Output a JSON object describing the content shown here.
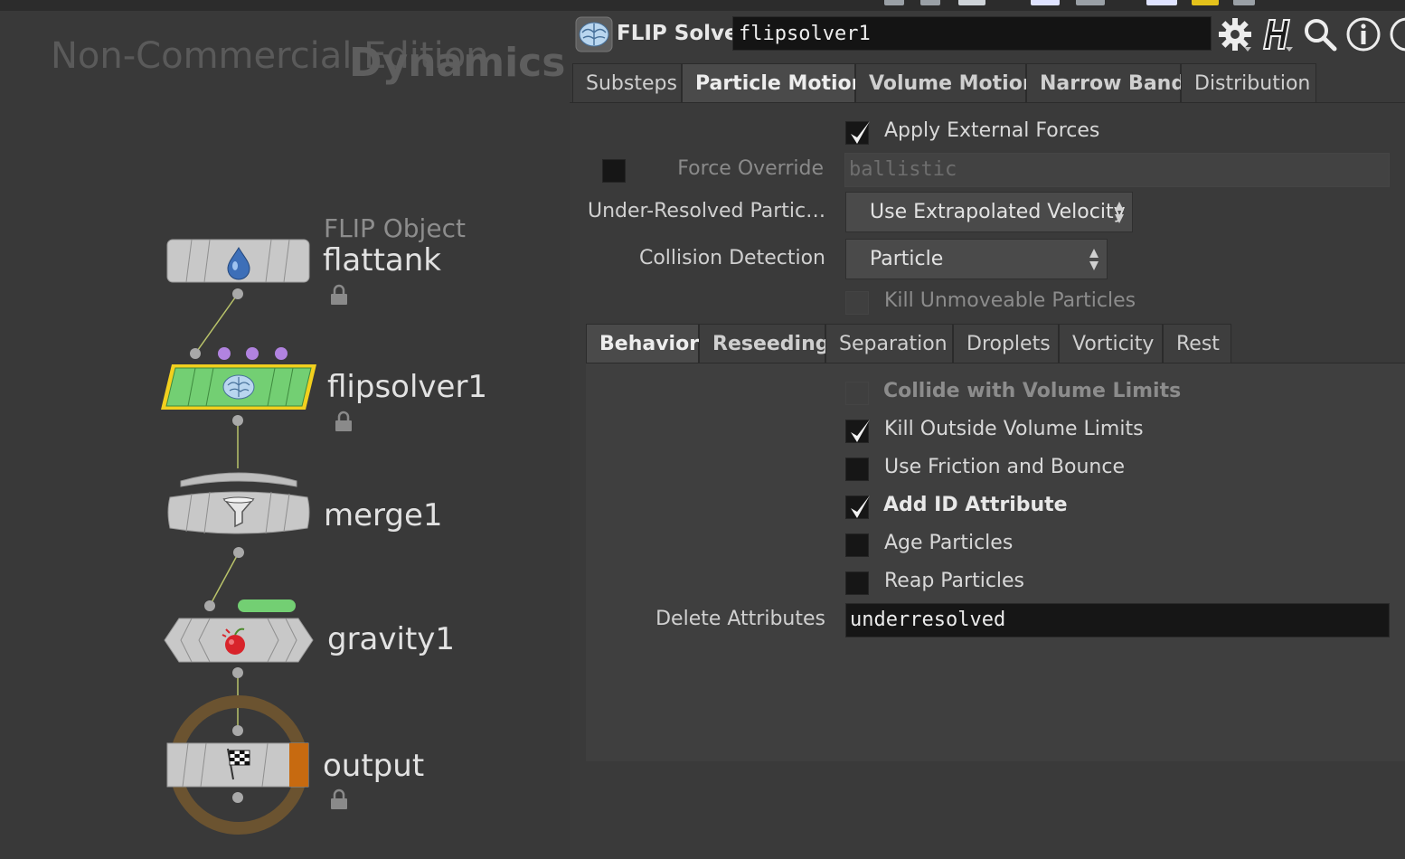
{
  "network": {
    "watermark": "Non-Commercial Edition",
    "context_label": "Dynamics",
    "nodes": [
      {
        "id": "flattank",
        "type_label": "FLIP Object",
        "name": "flattank",
        "locked": true
      },
      {
        "id": "flipsolver1",
        "name": "flipsolver1",
        "locked": true,
        "selected": true
      },
      {
        "id": "merge1",
        "name": "merge1"
      },
      {
        "id": "gravity1",
        "name": "gravity1"
      },
      {
        "id": "output",
        "name": "output",
        "locked": true
      }
    ],
    "colors": {
      "solver_node": "#73cf73",
      "selected_outline": "#f2d01e",
      "output_ring": "#6b5330",
      "output_flag": "#c76a10",
      "input_dot": "#b183e0"
    }
  },
  "parameters": {
    "header": {
      "node_type": "FLIP Solver",
      "node_name": "flipsolver1",
      "icons": [
        "brain-solver-icon",
        "gear-icon",
        "houdini-help-icon",
        "search-icon",
        "info-icon"
      ]
    },
    "main_tabs": [
      {
        "label": "Substeps"
      },
      {
        "label": "Particle Motion",
        "active": true
      },
      {
        "label": "Volume Motion"
      },
      {
        "label": "Narrow Band"
      },
      {
        "label": "Distribution"
      }
    ],
    "apply_external_forces": {
      "label": "Apply External Forces",
      "checked": true
    },
    "force_override": {
      "label": "Force Override",
      "value": "ballistic",
      "enabled": false
    },
    "under_resolved": {
      "label": "Under-Resolved Partic…",
      "value": "Use Extrapolated Velocity"
    },
    "collision_detection": {
      "label": "Collision Detection",
      "value": "Particle"
    },
    "kill_unmoveable": {
      "label": "Kill Unmoveable Particles",
      "enabled": false
    },
    "sub_tabs": [
      {
        "label": "Behavior",
        "active": true
      },
      {
        "label": "Reseeding"
      },
      {
        "label": "Separation"
      },
      {
        "label": "Droplets"
      },
      {
        "label": "Vorticity"
      },
      {
        "label": "Rest"
      }
    ],
    "behavior": {
      "collide_volume_limits": {
        "label": "Collide with Volume Limits",
        "enabled": false
      },
      "kill_outside_volume_limits": {
        "label": "Kill Outside Volume Limits",
        "checked": true
      },
      "use_friction_bounce": {
        "label": "Use Friction and Bounce",
        "checked": false
      },
      "add_id_attribute": {
        "label": "Add ID Attribute",
        "checked": true
      },
      "age_particles": {
        "label": "Age Particles",
        "checked": false
      },
      "reap_particles": {
        "label": "Reap Particles",
        "checked": false
      },
      "delete_attributes": {
        "label": "Delete Attributes",
        "value": "underresolved"
      }
    }
  }
}
